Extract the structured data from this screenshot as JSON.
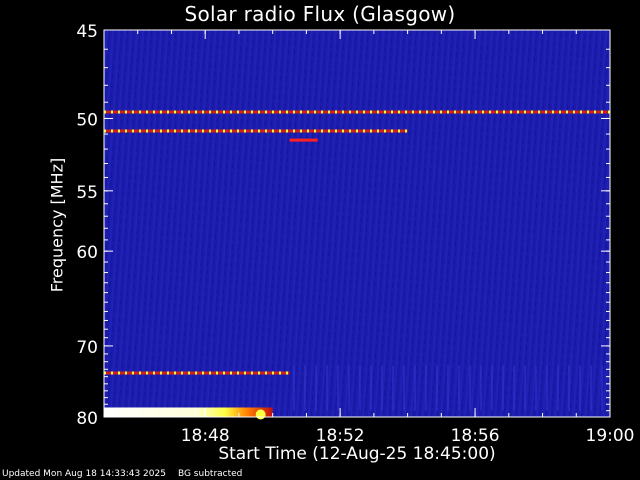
{
  "chart_data": {
    "type": "heatmap",
    "title": "Solar radio Flux (Glasgow)",
    "xlabel": "Start Time (12-Aug-25 18:45:00)",
    "ylabel": "Frequency [MHz]",
    "x_range": [
      "18:45:00",
      "19:00:00"
    ],
    "x_ticks": [
      "18:48",
      "18:52",
      "18:56",
      "19:00"
    ],
    "y_range_mhz": [
      45,
      80
    ],
    "y_scale": "reciprocal",
    "y_ticks": [
      45,
      50,
      55,
      60,
      70,
      80
    ],
    "background_color": "#1a1aa8",
    "colormap": [
      "#1a1aa8",
      "#ff2020",
      "#ffff40",
      "#ffffff"
    ],
    "features": [
      {
        "kind": "interference-band",
        "freq_mhz": 49.6,
        "start": "18:45:00",
        "end": "19:00:00",
        "intensity": "high",
        "pattern": "dashed"
      },
      {
        "kind": "interference-band",
        "freq_mhz": 50.8,
        "start": "18:45:00",
        "end": "18:54:00",
        "intensity": "high",
        "pattern": "dashed"
      },
      {
        "kind": "interference-band",
        "freq_mhz": 51.4,
        "start": "18:50:30",
        "end": "18:51:20",
        "intensity": "medium",
        "pattern": "solid"
      },
      {
        "kind": "interference-band",
        "freq_mhz": 73.5,
        "start": "18:45:00",
        "end": "18:50:30",
        "intensity": "high",
        "pattern": "dashed"
      },
      {
        "kind": "burst",
        "freq_mhz": [
          78.5,
          80.0
        ],
        "start": "18:45:00",
        "end": "18:50:00",
        "intensity": "saturated"
      }
    ]
  },
  "footer": {
    "updated": "Updated Mon Aug 18 14:33:43 2025",
    "note": "BG subtracted"
  }
}
